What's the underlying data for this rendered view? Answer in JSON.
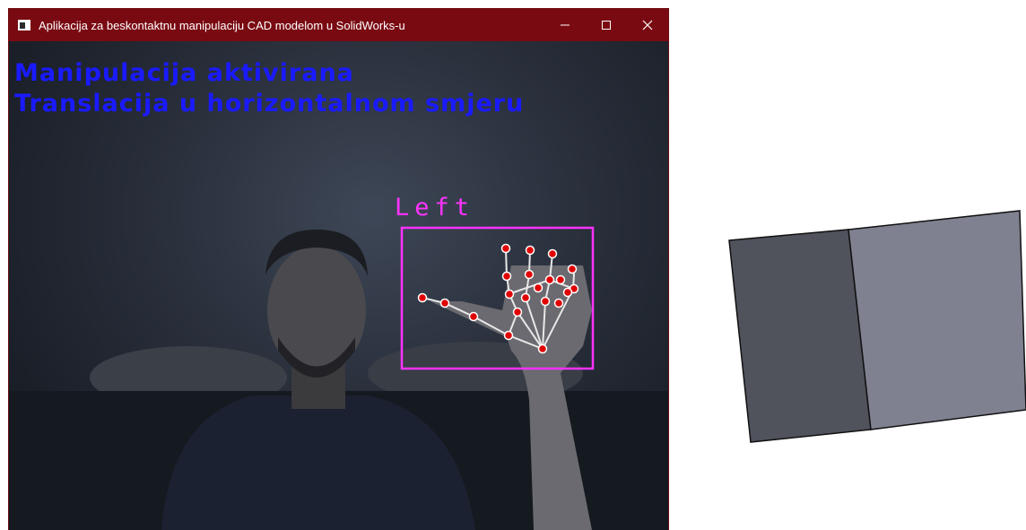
{
  "window": {
    "title": "Aplikacija za beskontaktnu manipulaciju CAD modelom u SolidWorks-u",
    "controls": [
      "minimize-icon",
      "maximize-icon",
      "close-icon"
    ]
  },
  "overlay": {
    "status_line1": "Manipulacija aktivirana",
    "status_line2": "Translacija u horizontalnom smjeru",
    "hand_label": "Left",
    "text_color": "#1a1aff",
    "label_color": "#ff33ff",
    "landmark_color": "#e00000"
  },
  "colors": {
    "titlebar": "#7a0a12",
    "model_face_dark": "#50525c",
    "model_face_light": "#7f8090"
  }
}
